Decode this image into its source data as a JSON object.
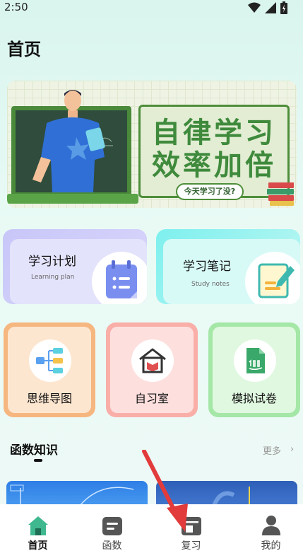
{
  "status_bar": {
    "time": "2:50"
  },
  "header": {
    "title": "首页"
  },
  "banner": {
    "line1": "自律学习",
    "line2": "效率加倍",
    "pill": "今天学习了没?"
  },
  "feature_cards": [
    {
      "title": "学习计划",
      "subtitle": "Learning plan"
    },
    {
      "title": "学习笔记",
      "subtitle": "Study notes"
    }
  ],
  "quick_cards": [
    {
      "label": "思维导图"
    },
    {
      "label": "自习室"
    },
    {
      "label": "模拟试卷"
    }
  ],
  "section": {
    "title": "函数知识",
    "more": "更多"
  },
  "tabbar": {
    "items": [
      {
        "label": "首页",
        "icon": "home-icon",
        "active": true
      },
      {
        "label": "函数",
        "icon": "function-icon",
        "active": false
      },
      {
        "label": "复习",
        "icon": "review-icon",
        "active": false
      },
      {
        "label": "我的",
        "icon": "user-icon",
        "active": false
      }
    ]
  },
  "colors": {
    "accent": "#3fb88f",
    "banner_green": "#3f8a3c",
    "annotation_arrow": "#e23b3b"
  }
}
